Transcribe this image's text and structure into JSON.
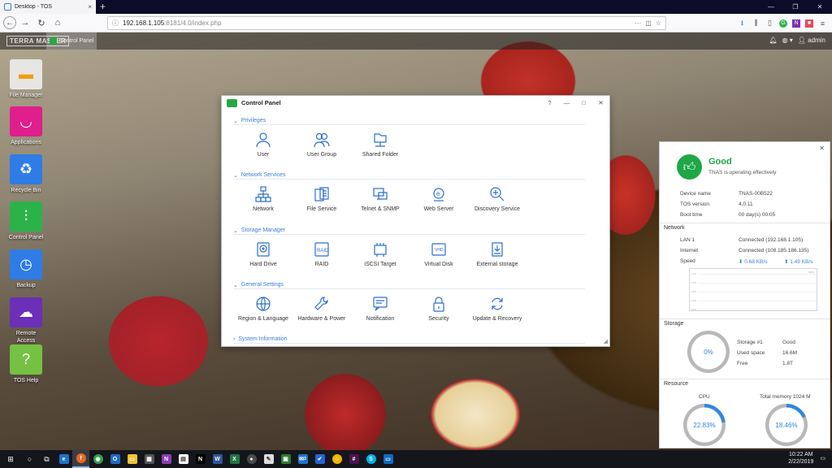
{
  "browser": {
    "tab_title": "Desktop - TOS",
    "tab_close": "×",
    "new_tab": "+",
    "url_host": "192.168.1.105",
    "url_rest": ":8181/4.0/index.php",
    "url_more": "···"
  },
  "tos": {
    "logo": "TERRA MASTER",
    "task_label": "Control Panel",
    "user": "admin"
  },
  "desktop_icons": [
    {
      "label": "File Manager",
      "color": "#e8e6e4",
      "glyph": "▬"
    },
    {
      "label": "Applications",
      "color": "#e01e8c",
      "glyph": "◡"
    },
    {
      "label": "Recycle Bin",
      "color": "#2e7ce6",
      "glyph": "♻"
    },
    {
      "label": "Control Panel",
      "color": "#2bb34a",
      "glyph": "⫶"
    },
    {
      "label": "Backup",
      "color": "#2e7ce6",
      "glyph": "◷"
    },
    {
      "label": "Remote Access",
      "color": "#6b2fb8",
      "glyph": "☁"
    },
    {
      "label": "TOS Help",
      "color": "#76c043",
      "glyph": "?"
    }
  ],
  "control_panel": {
    "title": "Control Panel",
    "help": "?",
    "minimize": "—",
    "maximize": "□",
    "close": "✕",
    "sections": [
      {
        "title": "Privileges",
        "items": [
          "User",
          "User Group",
          "Shared Folder"
        ]
      },
      {
        "title": "Network Services",
        "items": [
          "Network",
          "File Service",
          "Telnet & SNMP",
          "Web Server",
          "Discovery Service"
        ]
      },
      {
        "title": "Storage Manager",
        "items": [
          "Hard Drive",
          "RAID",
          "iSCSI Target",
          "Virtual Disk",
          "External storage"
        ]
      },
      {
        "title": "General Settings",
        "items": [
          "Region & Language",
          "Hardware & Power",
          "Notification",
          "Security",
          "Update & Recovery"
        ]
      },
      {
        "title": "System Information",
        "items": []
      }
    ]
  },
  "status": {
    "state": "Good",
    "message": "TNAS is operating effectively",
    "device_name_label": "Device name",
    "device_name": "TNAS-00B522",
    "tos_version_label": "TOS version",
    "tos_version": "4.0.11",
    "boot_time_label": "Boot time",
    "boot_time": "00 day(s) 00:05",
    "network_title": "Network",
    "lan_label": "LAN 1",
    "lan_value": "Connected (192.168.1.105)",
    "internet_label": "Internet",
    "internet_value": "Connected (108.185.186.135)",
    "speed_label": "Speed",
    "down_speed": "0.68 KB/s",
    "up_speed": "1.49 KB/s",
    "graph_unit": "KB/S",
    "graph_ticks": [
      "1.00",
      "0.75",
      "0.50",
      "0.25",
      "0.00"
    ],
    "storage_title": "Storage",
    "storage_pct_text": "0%",
    "storage_pct": 0,
    "storage_name_label": "Storage #1",
    "storage_name_value": "Good",
    "used_label": "Used space",
    "used_value": "16.6M",
    "free_label": "Free",
    "free_value": "1.8T",
    "resource_title": "Resource",
    "cpu_label": "CPU",
    "cpu_text": "22.83%",
    "cpu_pct": 22.83,
    "memory_label": "Total memory 1024 M",
    "memory_text": "18.46%",
    "memory_pct": 18.46
  },
  "taskbar": {
    "time": "10:22 AM",
    "date": "2/22/2019",
    "badge": "3"
  }
}
